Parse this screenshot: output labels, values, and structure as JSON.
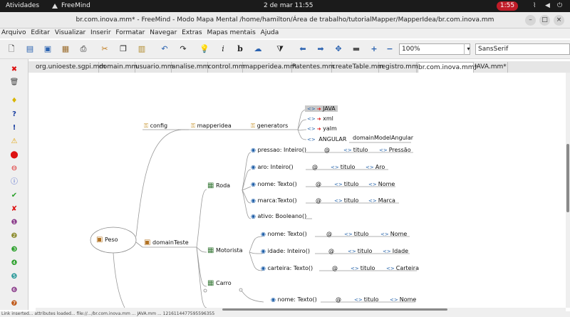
{
  "topbar": {
    "activities": "Atividades",
    "app_name": "FreeMind",
    "clock": "2 de mar  11:55",
    "recording": "1:55"
  },
  "window": {
    "title": "br.com.inova.mm* - FreeMind - Modo Mapa Mental /home/hamilton/Área de trabalho/tutorialMapper/MapperIdea/br.com.inova.mm"
  },
  "menu": [
    "Arquivo",
    "Editar",
    "Visualizar",
    "Inserir",
    "Formatar",
    "Navegar",
    "Extras",
    "Mapas mentais",
    "Ajuda"
  ],
  "toolbar": {
    "zoom": "100%",
    "font": "SansSerif"
  },
  "tabs": [
    "org.unioeste.sgpi.mm",
    "domain.mm",
    "usuario.mm",
    "analise.mm",
    "control.mm",
    "mapperidea.mm",
    "Patentes.mm",
    "createTable.mm",
    "registro.mm",
    "br.com.inova.mm*",
    "JAVA.mm*"
  ],
  "map": {
    "root": "Peso",
    "config": "config",
    "mapperidea": "mapperidea",
    "generators": "generators",
    "gen_java": "JAVA",
    "gen_xml": "xml",
    "gen_yalm": "yalm",
    "gen_angular": "ANGULAR",
    "gen_angular_val": "domainModelAngular",
    "domain": "domainTeste",
    "roda": "Roda",
    "motorista": "Motorista",
    "carro": "Carro",
    "at": "@",
    "titulo": "titulo",
    "roda_attrs": [
      {
        "name": "pressao: Inteiro()",
        "value": "Pressão"
      },
      {
        "name": "aro: Inteiro()",
        "value": "Aro"
      },
      {
        "name": "nome: Texto()",
        "value": "Nome"
      },
      {
        "name": "marca:Texto()",
        "value": "Marca"
      },
      {
        "name": "ativo: Booleano()"
      }
    ],
    "motorista_attrs": [
      {
        "name": "nome: Texto()",
        "value": "Nome"
      },
      {
        "name": "idade: Inteiro()",
        "value": "Idade"
      },
      {
        "name": "carteira: Texto()",
        "value": "Carteira"
      }
    ],
    "carro_attrs": [
      {
        "name": "nome: Texto()",
        "value": "Nome"
      }
    ]
  },
  "status": "Link inserted... attributes loaded... file://.../br.com.inova.mm ... JAVA.mm ... 1216114477595596355"
}
